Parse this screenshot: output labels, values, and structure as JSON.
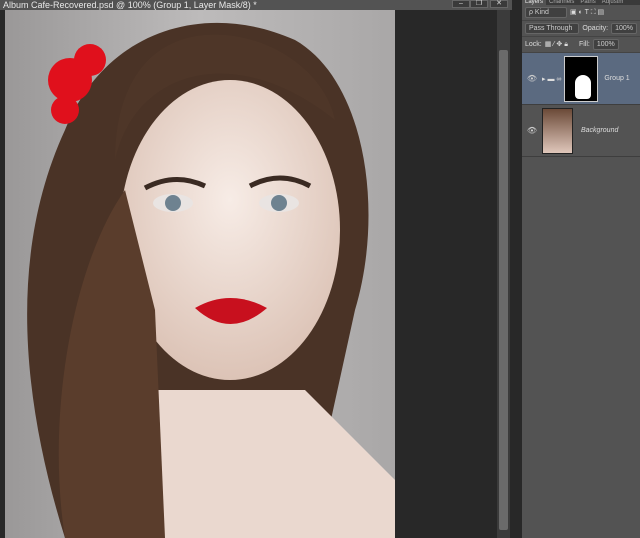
{
  "document": {
    "title": "Album Cafe-Recovered.psd @ 100% (Group 1, Layer Mask/8) *",
    "buttons": [
      "–",
      "❐",
      "✕"
    ]
  },
  "panel": {
    "tabs": [
      "Layers",
      "Channels",
      "Paths",
      "Adjustm"
    ],
    "filter": "ρ Kind",
    "blend_mode": "Pass Through",
    "opacity_label": "Opacity:",
    "opacity": "100%",
    "lock_label": "Lock:",
    "fill_label": "Fill:",
    "fill": "100%",
    "layers": [
      {
        "name": "Group 1",
        "selected": true,
        "type": "group"
      },
      {
        "name": "Background",
        "selected": false,
        "type": "image"
      }
    ]
  },
  "colors": {
    "selected_layer": "#5b6a80",
    "panel": "#535353"
  }
}
